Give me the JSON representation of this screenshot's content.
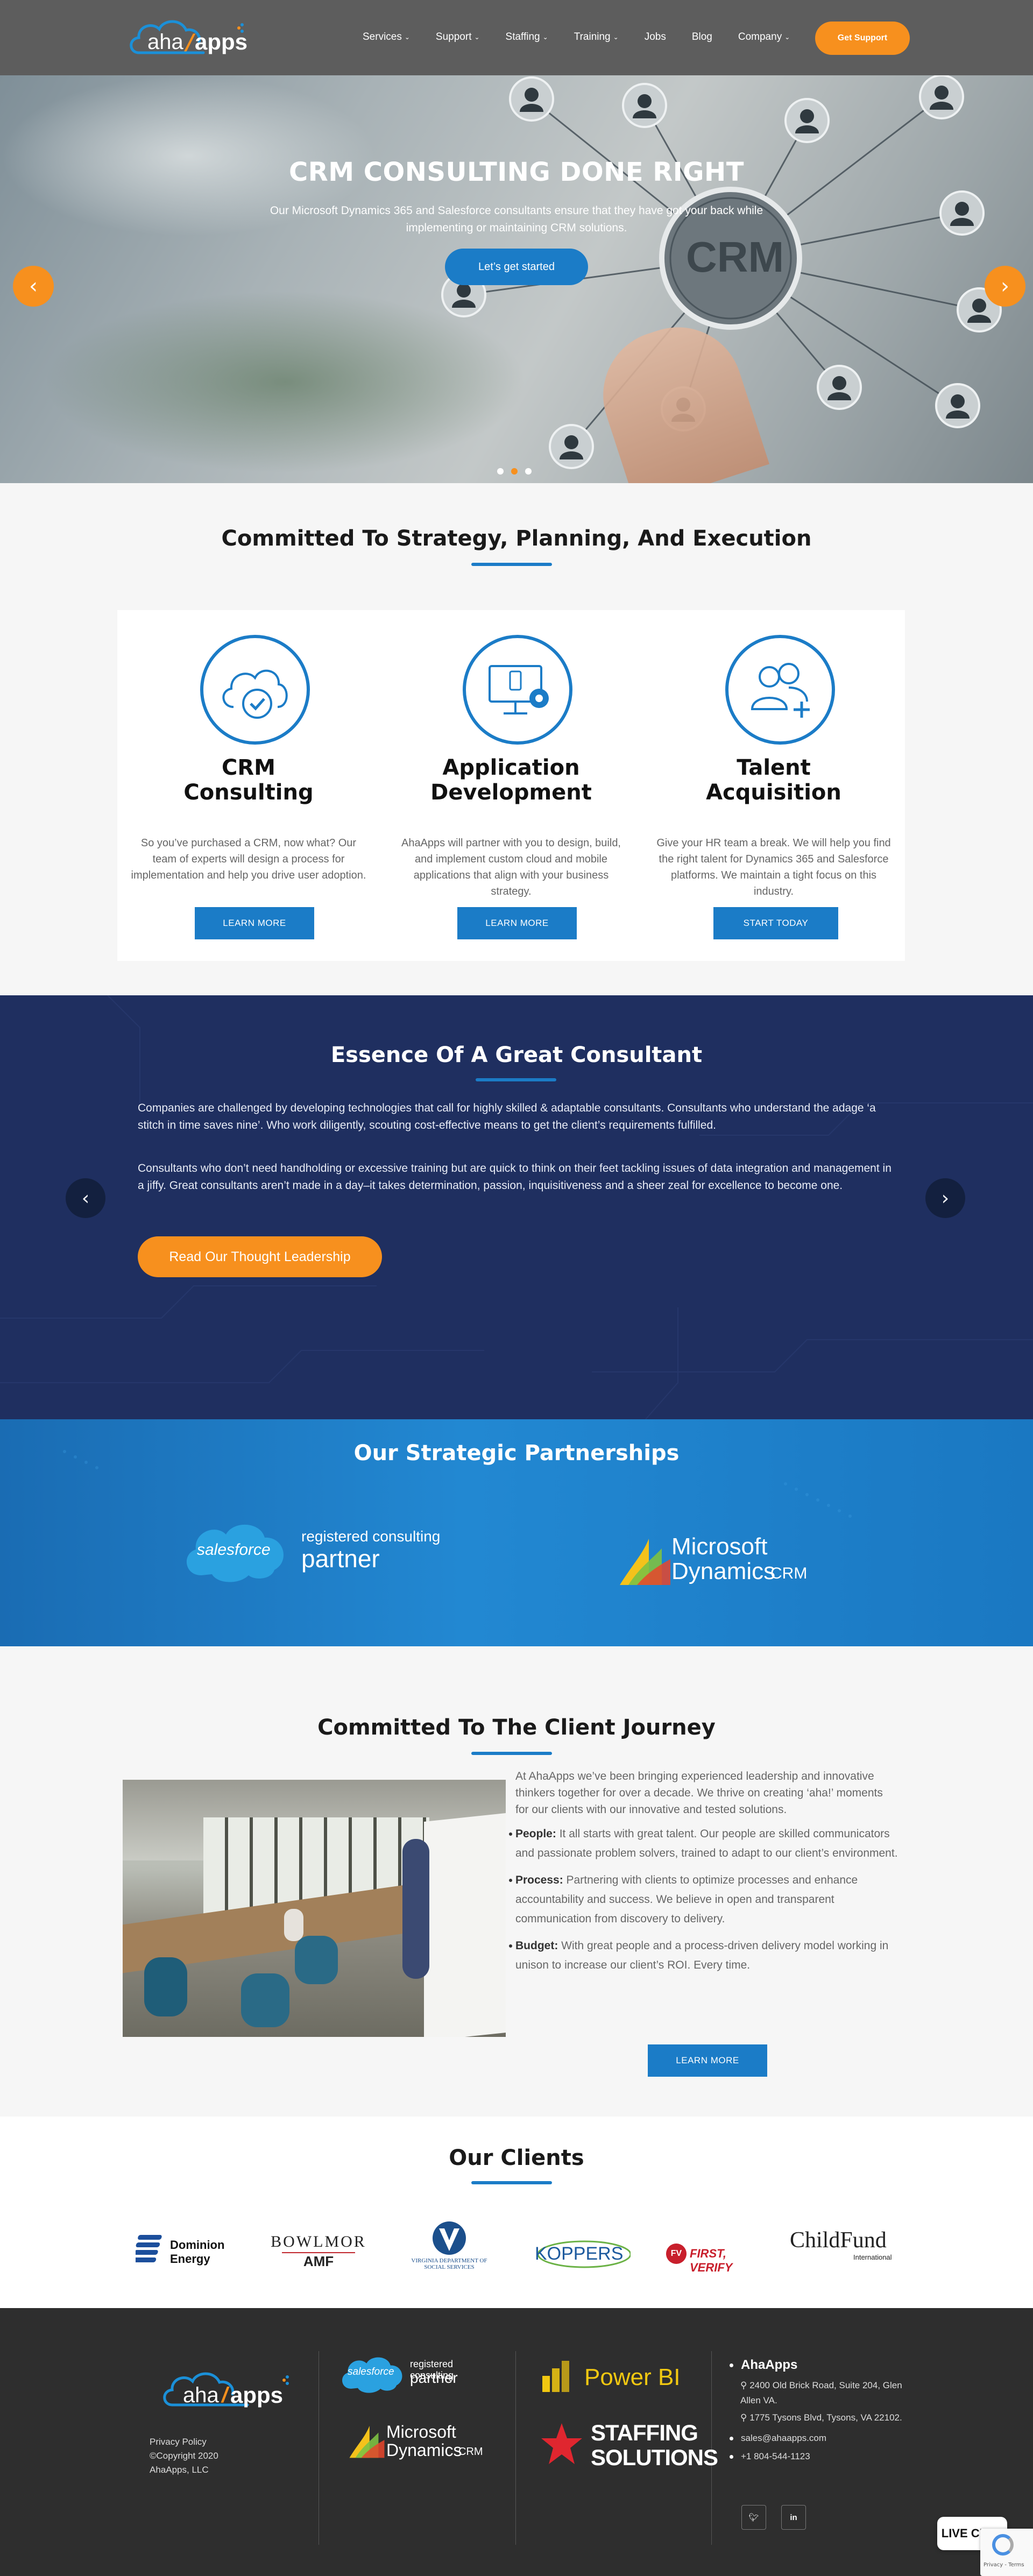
{
  "header": {
    "logo": {
      "left": "aha",
      "right": "apps"
    },
    "nav": [
      {
        "label": "Services",
        "dropdown": true
      },
      {
        "label": "Support",
        "dropdown": true
      },
      {
        "label": "Staffing",
        "dropdown": true
      },
      {
        "label": "Training",
        "dropdown": true
      },
      {
        "label": "Jobs",
        "dropdown": false
      },
      {
        "label": "Blog",
        "dropdown": false
      },
      {
        "label": "Company",
        "dropdown": true
      }
    ],
    "cta": "Get Support"
  },
  "hero": {
    "title": "CRM CONSULTING DONE RIGHT",
    "text": "Our Microsoft Dynamics 365 and Salesforce consultants ensure that they have got your back while implementing or maintaining CRM solutions.",
    "button": "Let’s get started",
    "badge": "CRM",
    "slides": 3,
    "active_slide": 2
  },
  "strategy": {
    "title": "Committed To Strategy, Planning, And Execution",
    "cards": [
      {
        "title1": "CRM",
        "title2": "Consulting",
        "icon": "cloud-check-icon",
        "text": "So you’ve purchased a CRM, now what? Our team of experts will design a process for implementation and help you drive user adoption.",
        "button": "LEARN MORE"
      },
      {
        "title1": "Application",
        "title2": "Development",
        "icon": "monitor-gear-icon",
        "text": "AhaApps will partner with you to design, build, and implement custom cloud and mobile applications that align with your business strategy.",
        "button": "LEARN MORE"
      },
      {
        "title1": "Talent",
        "title2": "Acquisition",
        "icon": "users-plus-icon",
        "text": "Give your HR team a break. We will help you find the right talent for Dynamics 365 and Salesforce platforms. We maintain a tight focus on this industry.",
        "button": "START TODAY"
      }
    ]
  },
  "essence": {
    "title": "Essence Of A Great Consultant",
    "p1": "Companies are challenged by developing technologies that call for highly skilled & adaptable consultants. Consultants who understand the adage ‘a stitch in time saves nine’.  Who work diligently, scouting cost-effective means to get the client’s requirements fulfilled.",
    "p2": "Consultants who don’t need handholding or excessive training but are quick to think on their feet tackling issues of data integration and management in a jiffy. Great consultants aren’t made in a day–it takes determination, passion, inquisitiveness and a sheer zeal for excellence to become one.",
    "button": "Read Our Thought Leadership"
  },
  "partners": {
    "title": "Our Strategic Partnerships",
    "salesforce": {
      "logo": "salesforce",
      "line1": "registered consulting",
      "line2": "partner"
    },
    "microsoft": {
      "line1": "Microsoft",
      "line2": "Dynamics",
      "suffix": "CRM"
    }
  },
  "journey": {
    "title": "Committed To The Client Journey",
    "intro": "At AhaApps we’ve been bringing experienced leadership and innovative thinkers together for over a decade. We thrive on creating ‘aha!’ moments for our clients with our innovative and tested solutions.",
    "bullets": [
      {
        "label": "People:",
        "text": " It all starts with great talent. Our people are skilled communicators and passionate problem solvers, trained to adapt to our client’s environment."
      },
      {
        "label": "Process:",
        "text": " Partnering with clients to optimize processes and enhance accountability and success. We believe in open and transparent communication from discovery to delivery."
      },
      {
        "label": "Budget:",
        "text": " With great people and a process-driven delivery model working in unison to increase our client’s ROI. Every time."
      }
    ],
    "button": "LEARN MORE"
  },
  "clients": {
    "title": "Our Clients",
    "logos": {
      "dominion": {
        "line1": "Dominion",
        "line2": "Energy"
      },
      "bowlmor": {
        "line1": "BOWLMOR",
        "line2": "AMF"
      },
      "virginia": {
        "line1": "VIRGINIA DEPARTMENT OF",
        "line2": "SOCIAL SERVICES"
      },
      "koppers": "KOPPERS",
      "firstverify": "FIRST, VERIFY",
      "childfund": {
        "line1": "ChildFund",
        "line2": "International"
      }
    }
  },
  "footer": {
    "privacy": "Privacy Policy",
    "copyright": "©Copyright 2020 AhaApps, LLC",
    "sf_line1": "registered consulting",
    "sf_line2": "partner",
    "ms_line1": "Microsoft",
    "ms_line2": "Dynamics",
    "ms_suffix": "CRM",
    "powerbi": "Power BI",
    "staffing1": "STAFFING",
    "staffing2": "SOLUTIONS",
    "company": "AhaApps",
    "address1": "2400 Old Brick Road, Suite 204, Glen Allen VA.",
    "address2": "1775 Tysons Blvd, Tysons, VA 22102.",
    "email": "sales@ahaapps.com",
    "phone": "+1 804-544-1123",
    "social": [
      "twitter-icon",
      "linkedin-icon"
    ],
    "live_chat": "LIVE CHAT",
    "recaptcha": "Privacy - Terms"
  },
  "colors": {
    "brand_blue": "#1b7cc7",
    "accent_orange": "#f7901e",
    "navy": "#1f2f60",
    "footer": "#2e2e2e"
  }
}
